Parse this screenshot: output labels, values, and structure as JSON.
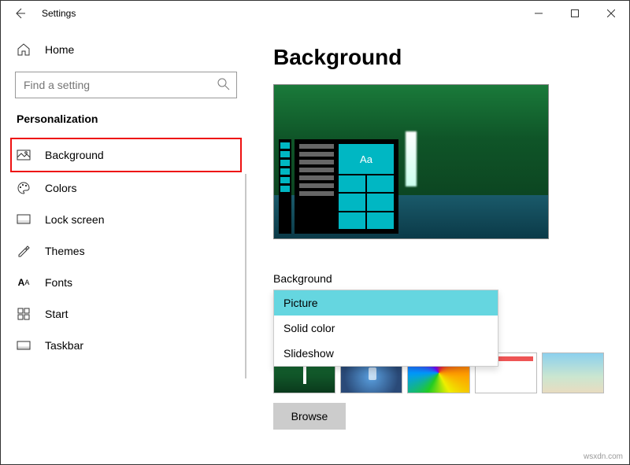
{
  "window": {
    "title": "Settings"
  },
  "sidebar": {
    "home_label": "Home",
    "search_placeholder": "Find a setting",
    "section": "Personalization",
    "items": [
      {
        "label": "Background",
        "icon": "picture",
        "selected": true
      },
      {
        "label": "Colors",
        "icon": "palette",
        "selected": false
      },
      {
        "label": "Lock screen",
        "icon": "lockscreen",
        "selected": false
      },
      {
        "label": "Themes",
        "icon": "themes",
        "selected": false
      },
      {
        "label": "Fonts",
        "icon": "fonts",
        "selected": false
      },
      {
        "label": "Start",
        "icon": "start",
        "selected": false
      },
      {
        "label": "Taskbar",
        "icon": "taskbar",
        "selected": false
      }
    ]
  },
  "main": {
    "heading": "Background",
    "preview_tile_text": "Aa",
    "dropdown_label": "Background",
    "dropdown": {
      "selected": "Picture",
      "options": [
        "Picture",
        "Solid color",
        "Slideshow"
      ]
    },
    "browse_label": "Browse"
  },
  "watermark": "wsxdn.com"
}
